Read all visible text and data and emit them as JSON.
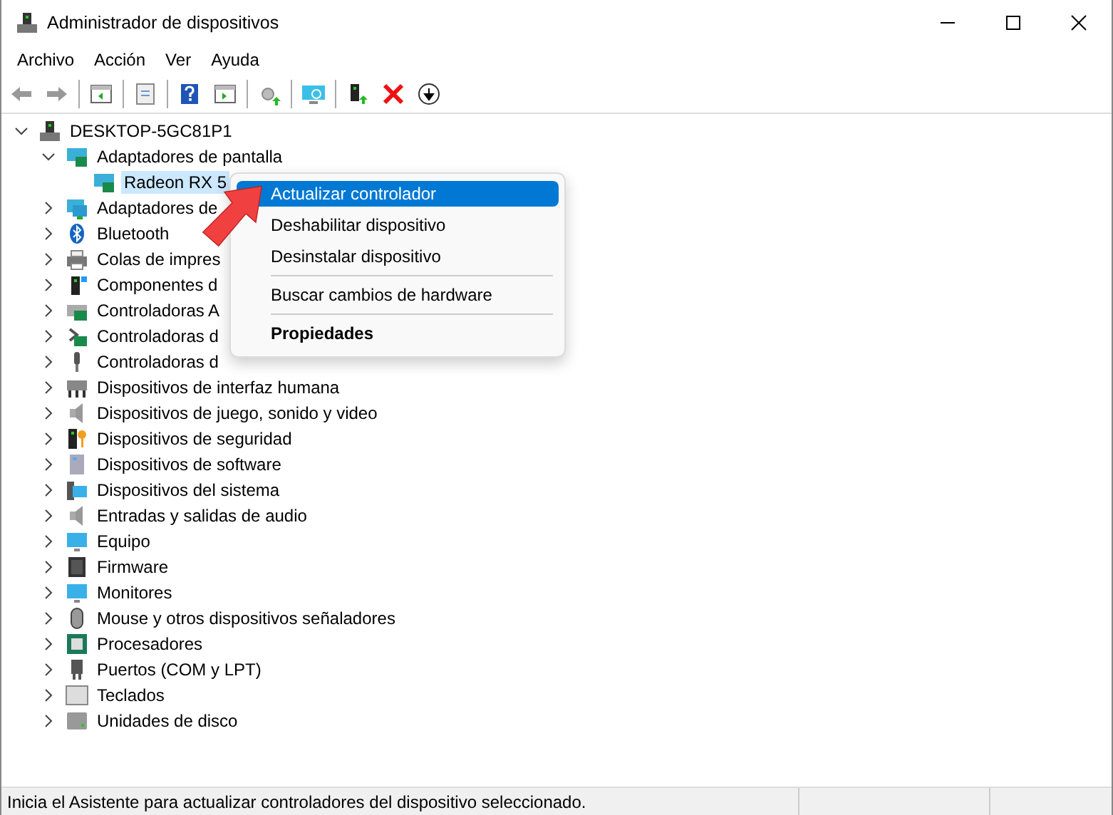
{
  "window": {
    "title": "Administrador de dispositivos"
  },
  "menu_bar": [
    "Archivo",
    "Acción",
    "Ver",
    "Ayuda"
  ],
  "tree": [
    {
      "label": "DESKTOP-5GC81P1",
      "expanded": true,
      "selected": false,
      "children": [
        {
          "label": "Adaptadores de pantalla",
          "expanded": true,
          "selected": false,
          "children": [
            {
              "label": "Radeon RX 5",
              "selected": true
            }
          ]
        },
        {
          "label": "Adaptadores de",
          "expanded": false,
          "selected": false
        },
        {
          "label": "Bluetooth",
          "expanded": false,
          "selected": false
        },
        {
          "label": "Colas de impres",
          "expanded": false,
          "selected": false
        },
        {
          "label": "Componentes d",
          "expanded": false,
          "selected": false
        },
        {
          "label": "Controladoras A",
          "expanded": false,
          "selected": false
        },
        {
          "label": "Controladoras d",
          "expanded": false,
          "selected": false
        },
        {
          "label": "Controladoras d",
          "expanded": false,
          "selected": false
        },
        {
          "label": "Dispositivos de interfaz humana",
          "expanded": false,
          "selected": false
        },
        {
          "label": "Dispositivos de juego, sonido y video",
          "expanded": false,
          "selected": false
        },
        {
          "label": "Dispositivos de seguridad",
          "expanded": false,
          "selected": false
        },
        {
          "label": "Dispositivos de software",
          "expanded": false,
          "selected": false
        },
        {
          "label": "Dispositivos del sistema",
          "expanded": false,
          "selected": false
        },
        {
          "label": "Entradas y salidas de audio",
          "expanded": false,
          "selected": false
        },
        {
          "label": "Equipo",
          "expanded": false,
          "selected": false
        },
        {
          "label": "Firmware",
          "expanded": false,
          "selected": false
        },
        {
          "label": "Monitores",
          "expanded": false,
          "selected": false
        },
        {
          "label": "Mouse y otros dispositivos señaladores",
          "expanded": false,
          "selected": false
        },
        {
          "label": "Procesadores",
          "expanded": false,
          "selected": false
        },
        {
          "label": "Puertos (COM y LPT)",
          "expanded": false,
          "selected": false
        },
        {
          "label": "Teclados",
          "expanded": false,
          "selected": false
        },
        {
          "label": "Unidades de disco",
          "expanded": false,
          "selected": false
        }
      ]
    }
  ],
  "context_menu": [
    {
      "kind": "item",
      "label": "Actualizar controlador",
      "selected": true
    },
    {
      "kind": "item",
      "label": "Deshabilitar dispositivo",
      "selected": false
    },
    {
      "kind": "item",
      "label": "Desinstalar dispositivo",
      "selected": false
    },
    {
      "kind": "separator"
    },
    {
      "kind": "item",
      "label": "Buscar cambios de hardware",
      "selected": false
    },
    {
      "kind": "separator"
    },
    {
      "kind": "default",
      "label": "Propiedades",
      "selected": false
    }
  ],
  "status_bar": {
    "text": "Inicia el Asistente para actualizar controladores del dispositivo seleccionado."
  }
}
